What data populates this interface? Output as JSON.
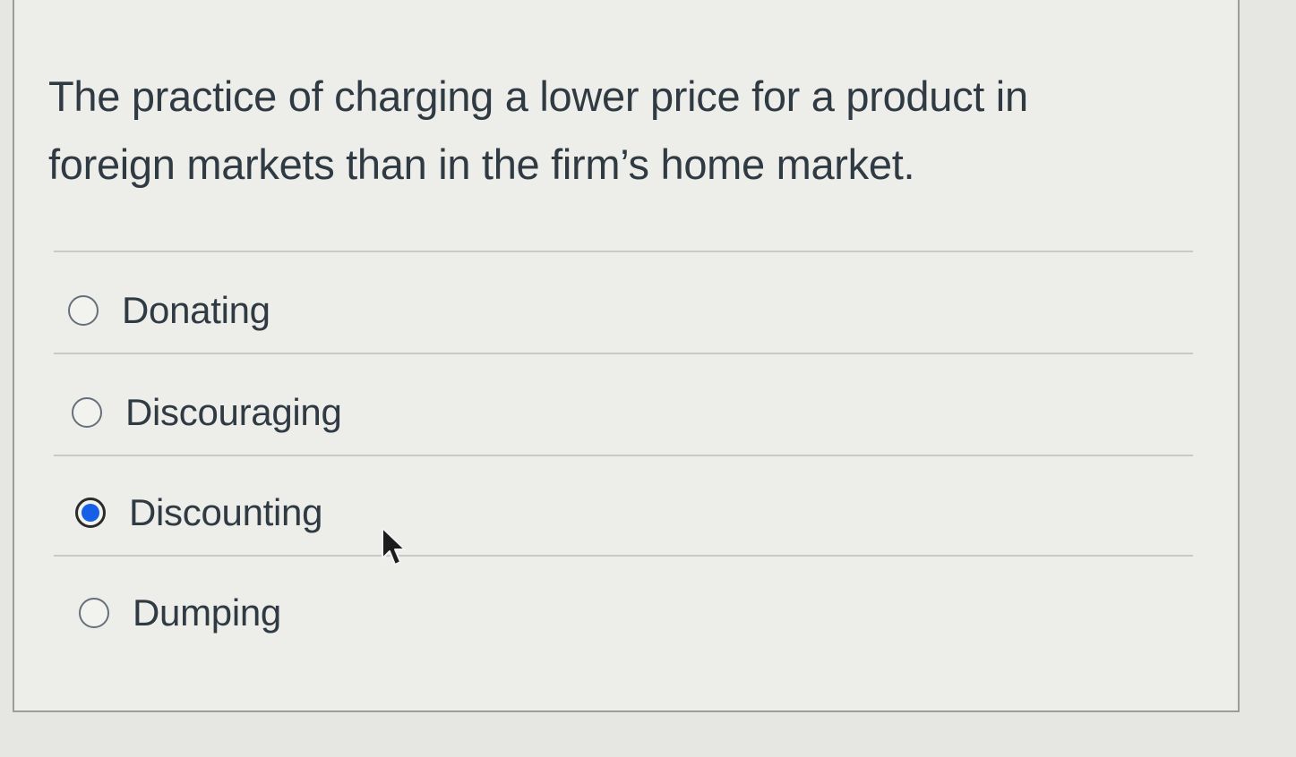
{
  "question": {
    "line1": "The practice of charging a lower price for a product in",
    "line2": "foreign markets than in the firm’s home market."
  },
  "answers": [
    {
      "label": "Donating",
      "selected": false
    },
    {
      "label": "Discouraging",
      "selected": false
    },
    {
      "label": "Discounting",
      "selected": true
    },
    {
      "label": "Dumping",
      "selected": false
    }
  ],
  "colors": {
    "accent": "#1660e8",
    "text": "#2f3a42",
    "background": "#ededea"
  },
  "cursor": {
    "icon": "mouse-pointer-icon"
  }
}
